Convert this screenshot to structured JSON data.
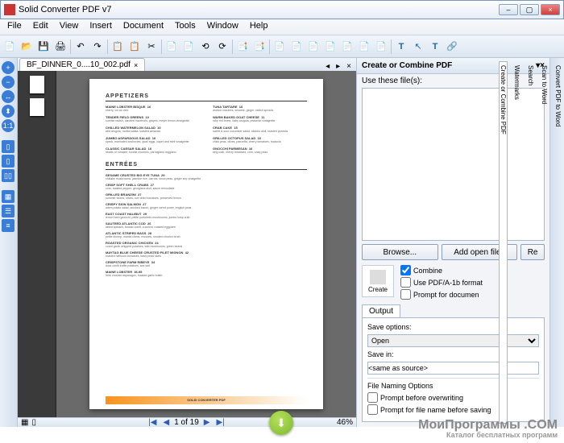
{
  "window": {
    "title": "Solid Converter PDF v7"
  },
  "menu": [
    "File",
    "Edit",
    "View",
    "Insert",
    "Document",
    "Tools",
    "Window",
    "Help"
  ],
  "tab": {
    "label": "BF_DINNER_0....10_002.pdf"
  },
  "pagectl": {
    "pos": "1 of 19",
    "zoom": "46%"
  },
  "doc": {
    "h1": "APPETIZERS",
    "h2": "ENTRÉES",
    "col1": [
      {
        "n": "MAINE LOBSTER BISQUE",
        "d": "sherry, vol au vent",
        "p": "16"
      },
      {
        "n": "TENDER FIELD GREENS",
        "d": "sunrise radish, candied hazelnuts, grapes, meyer lemon vinaigrette",
        "p": "10"
      },
      {
        "n": "CHILLED WATERMELON SALAD",
        "d": "wild arugula, ricotta salata, toasted almonds",
        "p": "10"
      },
      {
        "n": "JUMBO ASPARAGUS SALAD",
        "d": "speck, marinated anchovies, quail eggs, caper and mint vinaigrette",
        "p": "16"
      },
      {
        "n": "CLASSIC CAESAR SALAD",
        "d": "hearts of romaine, focelle croutons, parmigiano reggiano",
        "p": "10"
      }
    ],
    "col2": [
      {
        "n": "TUNA TARTARE",
        "d": "wonton crackers, sesame, ginger, radish sprouts",
        "p": "16"
      },
      {
        "n": "WARM BAKED GOAT CHEESE",
        "d": "ruby red beets, baby arugula, pistachio vinaigrette",
        "p": "11"
      },
      {
        "n": "CRAB CAKE",
        "d": "sweet & sour cucumber salad, cilantro aioli, toasted peanuts",
        "p": "15"
      },
      {
        "n": "GRILLED OCTOPUS SALAD",
        "d": "chick peas, olives, pancetta, cherry tomatoes, focaccia",
        "p": "16"
      },
      {
        "n": "GNOCCHI PARMESAN",
        "d": "king crab, cherry tomatoes, corn, snap peas",
        "p": "16"
      }
    ],
    "entrees": [
      {
        "n": "SESAME CRUSTED BIG EYE TUNA",
        "d": "shiitake mushrooms, jasmine rice, carrots, snow peas, ginger soy vinaigrette",
        "p": "29"
      },
      {
        "n": "CRISP SOFT SHELL CRABS",
        "d": "corn, toasted pepper, georgiana aioli, sauce remoulade",
        "p": "27"
      },
      {
        "n": "GRILLED BRANZINI",
        "d": "summer beans, olives, sun dried tomatoes, preserved lemon",
        "p": "27"
      },
      {
        "n": "CRISPY SKIN SALMON",
        "d": "warm potato salad, smoked bacon, ginger carrot puree, english peas",
        "p": "27"
      },
      {
        "n": "EAST COAST HALIBUT",
        "d": "lemon herb gnocchi, petite portobello mushrooms, jumbo lump crab",
        "p": "29"
      },
      {
        "n": "SAUTEED ATLANTIC COD",
        "d": "wilted spinach, tomato confit, zucchini, roasted eggplant",
        "p": "26"
      },
      {
        "n": "ATLANTIC STRIPED BASS",
        "d": "petite shrimp, manila clams, mussels, smoked chorizo broth",
        "p": "28"
      },
      {
        "n": "ROASTED ORGANIC CHICKEN",
        "d": "cured garlic whipped potatoes, wild mushrooms, green beans",
        "p": "24"
      },
      {
        "n": "MAYTAG BLUE CHEESE CRUSTED FILET MIGNON",
        "d": "roasted heirloom tomatoes, basil pesto skirls",
        "p": "42"
      },
      {
        "n": "CRISPSTONE FARM RIBEYE",
        "d": "duck confit truffle potatoes, sea salt",
        "p": "34"
      },
      {
        "n": "MAINE LOBSTER",
        "d": "herb crushed asparagus, roasted garlic butter",
        "p": "36.95"
      }
    ],
    "footer": "SOLID CONVERTER PDF"
  },
  "rightpane": {
    "title": "Create or Combine PDF",
    "use_label": "Use these file(s):",
    "browse": "Browse...",
    "addopen": "Add open files",
    "remove": "Re",
    "create": "Create",
    "opt_combine": "Combine",
    "opt_pdfa": "Use PDF/A-1b format",
    "opt_prompt": "Prompt for documen",
    "output_tab": "Output",
    "save_options": "Save options:",
    "save_sel": "Open",
    "save_in": "Save in:",
    "save_in_val": "<same as source>",
    "fno": "File Naming Options",
    "fno1": "Prompt before overwriting",
    "fno2": "Prompt for file name before saving"
  },
  "rightstrip": [
    "Convert PDF to Word",
    "Scan to Word",
    "Search",
    "Watermarks",
    "Create or Combine PDF"
  ],
  "watermark": {
    "main": "МоиПрограммы .COM",
    "sub": "Каталог бесплатных программ"
  }
}
